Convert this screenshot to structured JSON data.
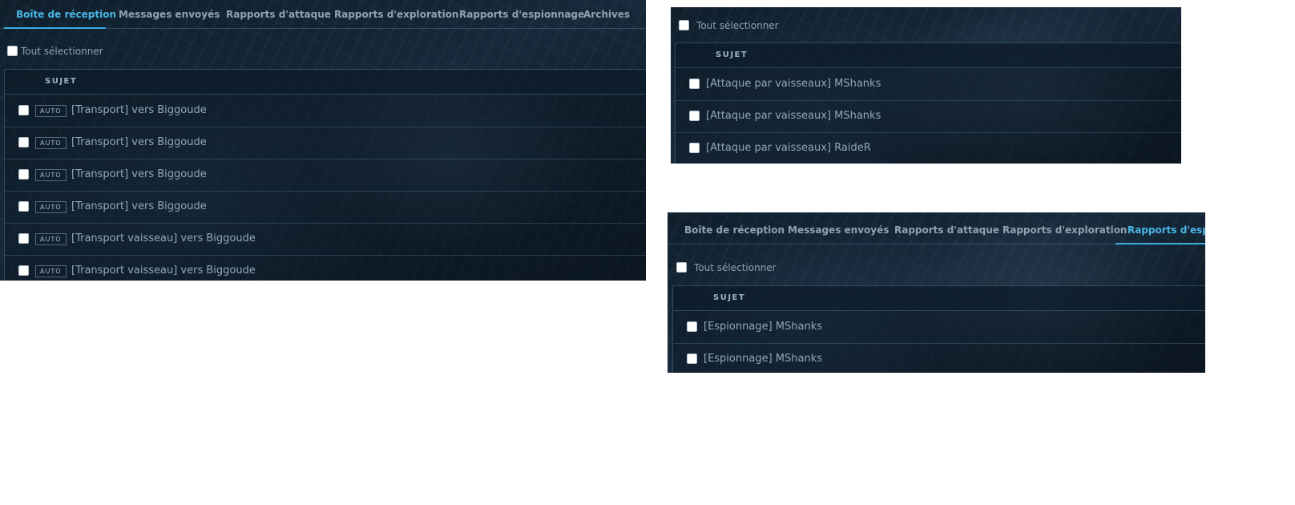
{
  "panel_a": {
    "tabs": [
      {
        "label": "Boîte de réception",
        "active": true
      },
      {
        "label": "Messages envoyés",
        "active": false
      },
      {
        "label": "Rapports d'attaque",
        "active": false
      },
      {
        "label": "Rapports d'exploration",
        "active": false
      },
      {
        "label": "Rapports d'espionnage",
        "active": false
      },
      {
        "label": "Archives",
        "active": false
      }
    ],
    "select_all_label": "Tout sélectionner",
    "column_header": "SUJET",
    "rows": [
      {
        "badge": "AUTO",
        "subject": "[Transport] vers Biggoude"
      },
      {
        "badge": "AUTO",
        "subject": "[Transport] vers Biggoude"
      },
      {
        "badge": "AUTO",
        "subject": "[Transport] vers Biggoude"
      },
      {
        "badge": "AUTO",
        "subject": "[Transport] vers Biggoude"
      },
      {
        "badge": "AUTO",
        "subject": "[Transport vaisseau] vers Biggoude"
      },
      {
        "badge": "AUTO",
        "subject": "[Transport vaisseau] vers Biggoude"
      }
    ]
  },
  "panel_b": {
    "select_all_label": "Tout sélectionner",
    "column_header": "SUJET",
    "rows": [
      {
        "subject": "[Attaque par vaisseaux] MShanks"
      },
      {
        "subject": "[Attaque par vaisseaux] MShanks"
      },
      {
        "subject": "[Attaque par vaisseaux] RaideR"
      }
    ]
  },
  "panel_c": {
    "tabs": [
      {
        "label": "Boîte de réception",
        "active": false
      },
      {
        "label": "Messages envoyés",
        "active": false
      },
      {
        "label": "Rapports d'attaque",
        "active": false
      },
      {
        "label": "Rapports d'exploration",
        "active": false
      },
      {
        "label": "Rapports d'espionnage",
        "active": true
      }
    ],
    "select_all_label": "Tout sélectionner",
    "column_header": "SUJET",
    "rows": [
      {
        "subject": "[Espionnage] MShanks"
      },
      {
        "subject": "[Espionnage] MShanks"
      }
    ]
  },
  "colors": {
    "active_tab": "#49b6e6",
    "tab_text": "#8fa3b2",
    "body_text": "#92a8b8",
    "panel_background": "#0b1722"
  }
}
